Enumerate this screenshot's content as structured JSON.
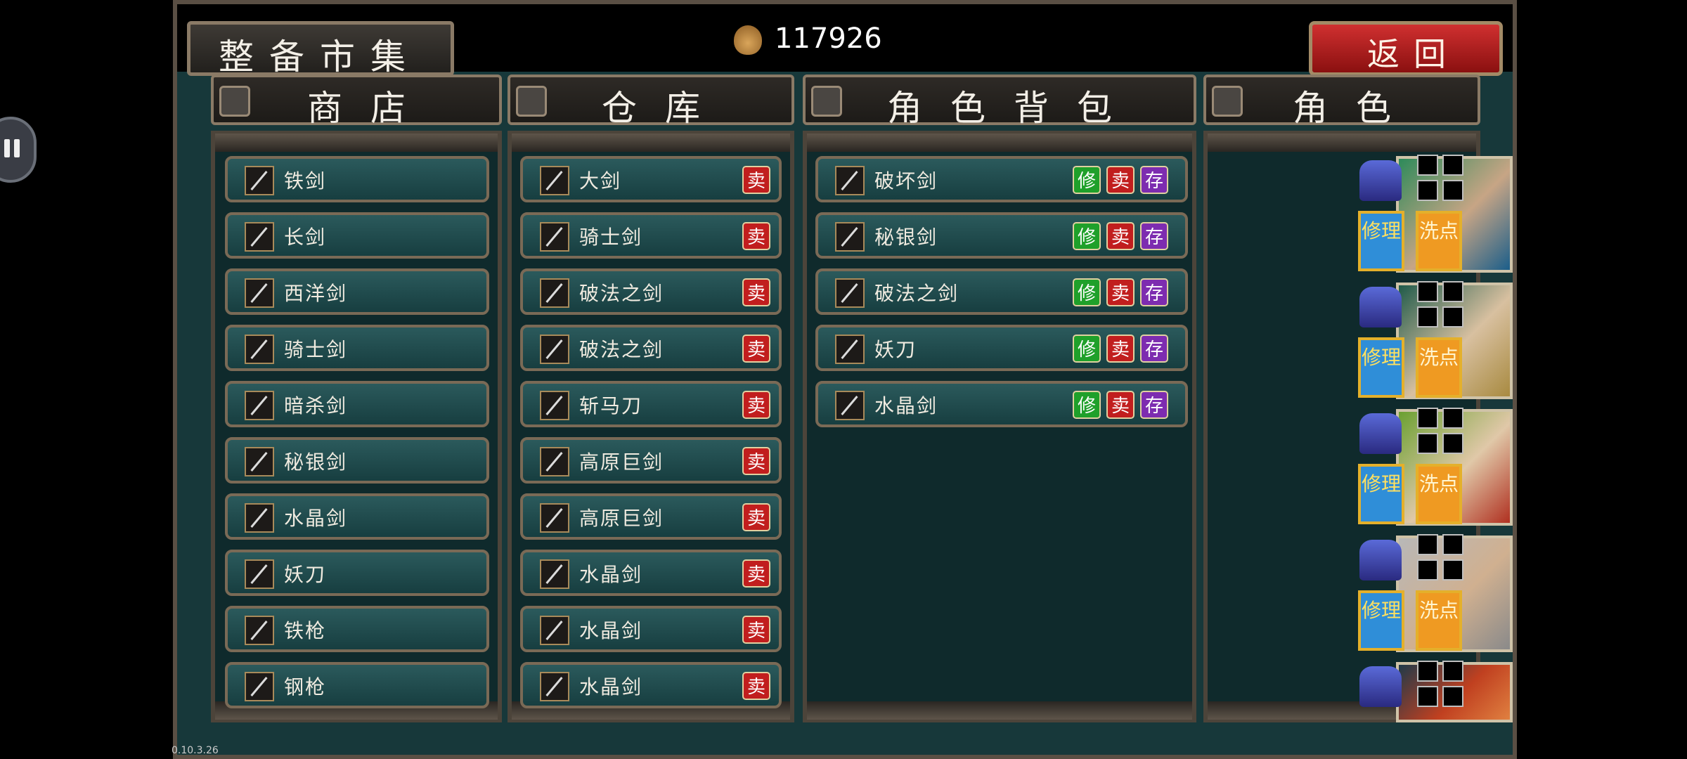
{
  "header": {
    "title": "整备市集",
    "gold": "117926",
    "back_label": "返回"
  },
  "panels": {
    "shop": "商店",
    "warehouse": "仓库",
    "bag": "角色背包",
    "character": "角色"
  },
  "shop_items": [
    "铁剑",
    "长剑",
    "西洋剑",
    "骑士剑",
    "暗杀剑",
    "秘银剑",
    "水晶剑",
    "妖刀",
    "铁枪",
    "钢枪"
  ],
  "warehouse_items": [
    "大剑",
    "骑士剑",
    "破法之剑",
    "破法之剑",
    "斩马刀",
    "高原巨剑",
    "高原巨剑",
    "水晶剑",
    "水晶剑",
    "水晶剑"
  ],
  "bag_items": [
    "破坏剑",
    "秘银剑",
    "破法之剑",
    "妖刀",
    "水晶剑"
  ],
  "buttons": {
    "sell": "卖",
    "repair": "修",
    "store": "存",
    "char_repair": "修理",
    "char_reset": "洗点"
  },
  "version": "0.10.3.26",
  "icons": {
    "gold": "coin-bag-icon",
    "panel_header": "bag-icon"
  },
  "colors": {
    "background": "#17383a",
    "sell": "#c11e1e",
    "repair": "#1fa02a",
    "store": "#7d2cb0",
    "back": "#d03030"
  }
}
